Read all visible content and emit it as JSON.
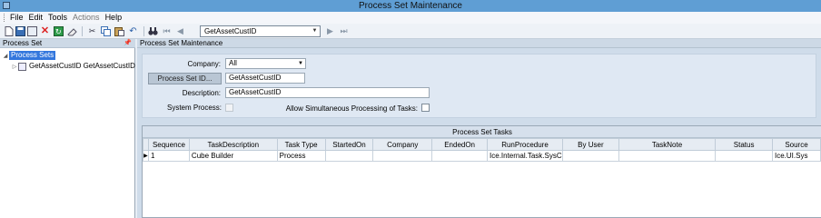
{
  "window": {
    "title": "Process Set Maintenance"
  },
  "menu": {
    "items": [
      "File",
      "Edit",
      "Tools",
      "Actions",
      "Help"
    ]
  },
  "toolbar": {
    "icons": [
      "new-icon",
      "save-icon",
      "delete-icon",
      "refresh-icon",
      "clear-icon",
      "cut-icon",
      "copy-icon",
      "paste-icon",
      "undo-icon",
      "binoculars-icon",
      "first-record-icon",
      "previous-record-icon",
      "next-record-icon",
      "last-record-icon"
    ],
    "record_combo": "GetAssetCustID"
  },
  "left_panel": {
    "title": "Process Set",
    "tree": {
      "root_label": "Process Sets",
      "child_label": "GetAssetCustID  GetAssetCustID"
    }
  },
  "right_panel": {
    "title": "Process Set Maintenance"
  },
  "form": {
    "company_label": "Company:",
    "company_value": "All",
    "process_set_id_button": "Process Set ID...",
    "process_set_id_value": "GetAssetCustID",
    "description_label": "Description:",
    "description_value": "GetAssetCustID",
    "system_process_label": "System Process:",
    "allow_simultaneous_label": "Allow Simultaneous Processing of Tasks:"
  },
  "tasks_grid": {
    "caption": "Process Set Tasks",
    "columns": [
      "Sequence",
      "TaskDescription",
      "Task Type",
      "StartedOn",
      "Company",
      "EndedOn",
      "RunProcedure",
      "By User",
      "TaskNote",
      "Status",
      "Source"
    ],
    "rows": [
      [
        "1",
        "Cube Builder",
        "Process",
        "",
        "",
        "",
        "Ice.Internal.Task.SysC",
        "",
        "",
        "",
        "Ice.UI.Sys"
      ]
    ]
  },
  "colors": {
    "titlebar": "#5f9ed4",
    "selection": "#3377dd",
    "form_bg": "#dfe8f3"
  }
}
